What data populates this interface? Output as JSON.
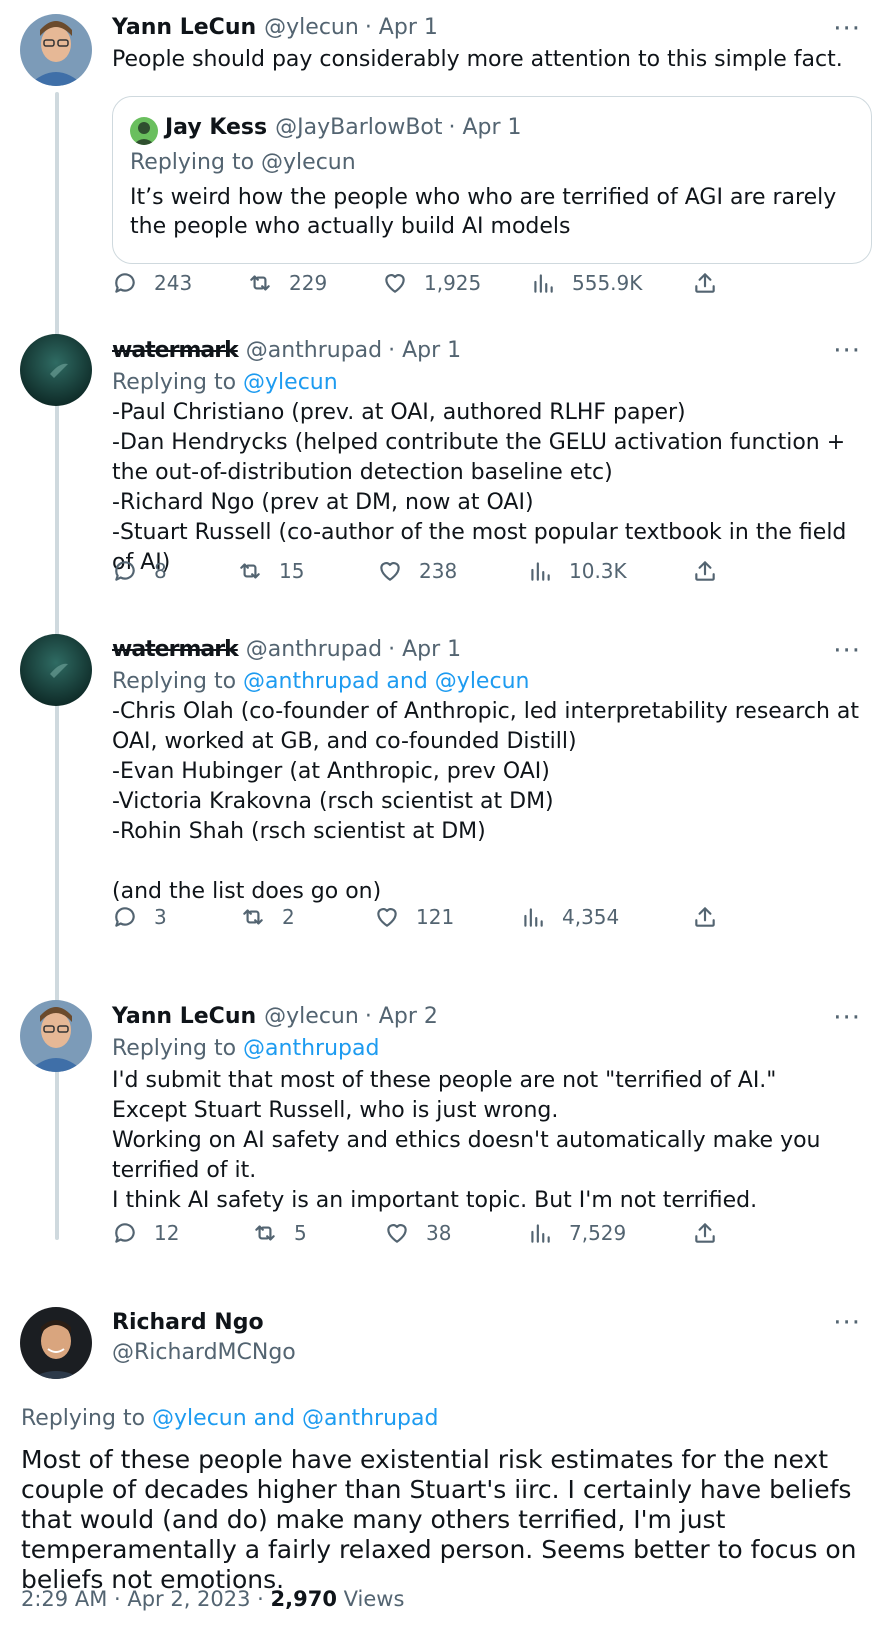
{
  "tweets": [
    {
      "name": "Yann LeCun",
      "handle": "@ylecun",
      "date": "· Apr 1",
      "body": "People should pay considerably more attention to this simple fact.",
      "quote": {
        "name": "Jay Kess",
        "handle": "@JayBarlowBot",
        "date": "· Apr 1",
        "replying_prefix": "Replying to",
        "replying_to": "@ylecun",
        "body": "It’s weird how the people who who are terrified of AGI are rarely the people who actually build AI models"
      },
      "stats": {
        "replies": "243",
        "retweets": "229",
        "likes": "1,925",
        "views": "555.9K"
      }
    },
    {
      "name": "watermark",
      "handle": "@anthrupad",
      "date": "· Apr 1",
      "replying_prefix": "Replying to",
      "replying_to": "@ylecun",
      "body": "-Paul Christiano (prev. at OAI, authored RLHF paper)\n-Dan Hendrycks (helped contribute the GELU activation function + the out-of-distribution detection baseline etc)\n-Richard Ngo (prev at DM, now at OAI)\n-Stuart Russell (co-author of the most popular textbook in the field of AI)",
      "stats": {
        "replies": "8",
        "retweets": "15",
        "likes": "238",
        "views": "10.3K"
      }
    },
    {
      "name": "watermark",
      "handle": "@anthrupad",
      "date": "· Apr 1",
      "replying_prefix": "Replying to",
      "replying_to": "@anthrupad and @ylecun",
      "body": "-Chris Olah (co-founder of Anthropic, led interpretability research at OAI, worked at GB, and co-founded Distill)\n-Evan Hubinger (at Anthropic, prev OAI)\n-Victoria Krakovna (rsch scientist at DM)\n-Rohin Shah (rsch scientist at DM)\n\n(and the list does go on)",
      "stats": {
        "replies": "3",
        "retweets": "2",
        "likes": "121",
        "views": "4,354"
      }
    },
    {
      "name": "Yann LeCun",
      "handle": "@ylecun",
      "date": "· Apr 2",
      "replying_prefix": "Replying to",
      "replying_to": "@anthrupad",
      "body": "I'd submit that most of these people are not \"terrified of AI.\"\nExcept Stuart Russell, who is just wrong.\nWorking on AI safety and ethics doesn't automatically make you terrified of it.\nI think AI safety is an important topic. But I'm not terrified.",
      "stats": {
        "replies": "12",
        "retweets": "5",
        "likes": "38",
        "views": "7,529"
      }
    }
  ],
  "main": {
    "name": "Richard Ngo",
    "handle": "@RichardMCNgo",
    "replying_prefix": "Replying to",
    "replying_to": "@ylecun and @anthrupad",
    "body": "Most of these people have existential risk estimates for the next couple of decades higher than Stuart's iirc. I certainly have beliefs that would (and do) make many others terrified, I'm just temperamentally a fairly relaxed person. Seems better to focus on beliefs not emotions.",
    "timestamp": "2:29 AM · Apr 2, 2023 · ",
    "views_count": "2,970",
    "views_label": " Views"
  },
  "more_label": "···",
  "colors": {
    "accent": "#1d9bf0",
    "muted": "#536471",
    "text": "#0f1419",
    "line": "#cfd9de"
  },
  "icons": [
    "reply-icon",
    "retweet-icon",
    "like-icon",
    "views-icon",
    "share-icon",
    "more-icon"
  ]
}
